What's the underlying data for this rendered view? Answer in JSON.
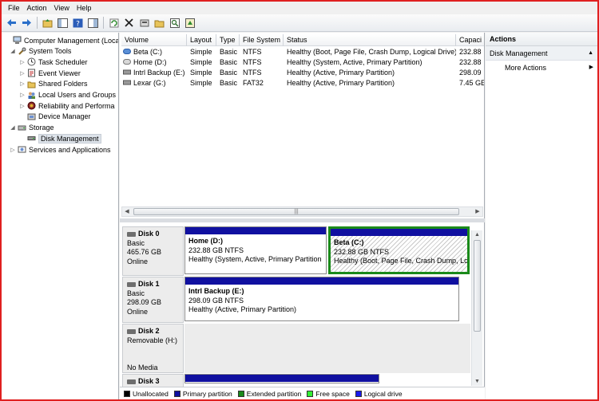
{
  "menu": [
    "File",
    "Action",
    "View",
    "Help"
  ],
  "toolbar": {
    "icons": [
      "back-arrow-icon",
      "forward-arrow-icon",
      "up-folder-icon",
      "show-hide-tree-icon",
      "help-icon",
      "properties-icon",
      "refresh-icon",
      "delete-icon",
      "settings-icon",
      "open-folder-icon",
      "search-icon",
      "rescan-icon"
    ]
  },
  "tree": {
    "items": [
      {
        "label": "Computer Management (Local",
        "level": 0,
        "arrow": "",
        "icon": "computer-icon"
      },
      {
        "label": "System Tools",
        "level": 1,
        "arrow": "◢",
        "icon": "tools-icon"
      },
      {
        "label": "Task Scheduler",
        "level": 2,
        "arrow": "▷",
        "icon": "clock-icon"
      },
      {
        "label": "Event Viewer",
        "level": 2,
        "arrow": "▷",
        "icon": "event-log-icon"
      },
      {
        "label": "Shared Folders",
        "level": 2,
        "arrow": "▷",
        "icon": "folder-icon"
      },
      {
        "label": "Local Users and Groups",
        "level": 2,
        "arrow": "▷",
        "icon": "users-icon"
      },
      {
        "label": "Reliability and Performa",
        "level": 2,
        "arrow": "▷",
        "icon": "performance-icon"
      },
      {
        "label": "Device Manager",
        "level": 2,
        "arrow": "",
        "icon": "device-icon"
      },
      {
        "label": "Storage",
        "level": 1,
        "arrow": "◢",
        "icon": "storage-icon"
      },
      {
        "label": "Disk Management",
        "level": 2,
        "arrow": "",
        "icon": "disk-icon",
        "selected": true
      },
      {
        "label": "Services and Applications",
        "level": 1,
        "arrow": "▷",
        "icon": "services-icon"
      }
    ]
  },
  "volumes": {
    "headers": [
      "Volume",
      "Layout",
      "Type",
      "File System",
      "Status",
      "Capaci"
    ],
    "rows": [
      {
        "volume": "Beta (C:)",
        "layout": "Simple",
        "type": "Basic",
        "fs": "NTFS",
        "status": "Healthy (Boot, Page File, Crash Dump, Logical Drive)",
        "capacity": "232.88"
      },
      {
        "volume": "Home (D:)",
        "layout": "Simple",
        "type": "Basic",
        "fs": "NTFS",
        "status": "Healthy (System, Active, Primary Partition)",
        "capacity": "232.88"
      },
      {
        "volume": "Intrl Backup (E:)",
        "layout": "Simple",
        "type": "Basic",
        "fs": "NTFS",
        "status": "Healthy (Active, Primary Partition)",
        "capacity": "298.09"
      },
      {
        "volume": "Lexar (G:)",
        "layout": "Simple",
        "type": "Basic",
        "fs": "FAT32",
        "status": "Healthy (Active, Primary Partition)",
        "capacity": "7.45 GE"
      }
    ]
  },
  "disks": [
    {
      "name": "Disk 0",
      "line1": "Basic",
      "line2": "465.76 GB",
      "line3": "Online",
      "partitions": [
        {
          "title": "Home  (D:)",
          "size": "232.88 GB NTFS",
          "status": "Healthy (System, Active, Primary Partition"
        },
        {
          "title": "Beta  (C:)",
          "size": "232.88 GB NTFS",
          "status": "Healthy (Boot, Page File, Crash Dump, Lo"
        }
      ]
    },
    {
      "name": "Disk 1",
      "line1": "Basic",
      "line2": "298.09 GB",
      "line3": "Online",
      "partitions": [
        {
          "title": "Intrl Backup  (E:)",
          "size": "298.09 GB NTFS",
          "status": "Healthy (Active, Primary Partition)"
        }
      ]
    },
    {
      "name": "Disk 2",
      "line1": "Removable (H:)",
      "line2": "",
      "line3": "No Media",
      "partitions": []
    },
    {
      "name": "Disk 3",
      "line1": "",
      "line2": "",
      "line3": "",
      "partitions": []
    }
  ],
  "legend": [
    {
      "label": "Unallocated",
      "color": "#000000"
    },
    {
      "label": "Primary partition",
      "color": "#1010a0"
    },
    {
      "label": "Extended partition",
      "color": "#1a8a1a"
    },
    {
      "label": "Free space",
      "color": "#33ee33"
    },
    {
      "label": "Logical drive",
      "color": "#1a1aee"
    }
  ],
  "actions": {
    "title": "Actions",
    "section": "Disk Management",
    "more": "More Actions"
  },
  "colors": {
    "primary_bar": "#1010a0",
    "selection_border": "#1a8a1a",
    "frame_border": "#e02020"
  }
}
